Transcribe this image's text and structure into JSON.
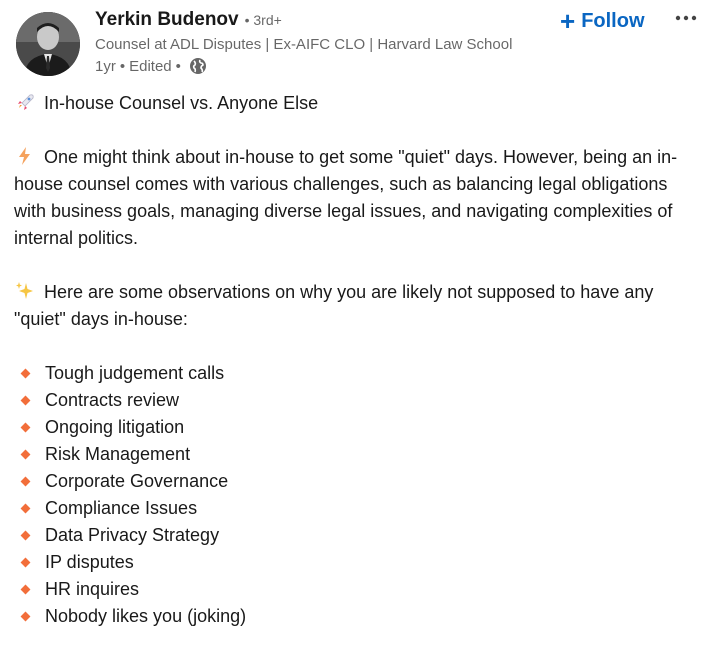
{
  "author": {
    "name": "Yerkin Budenov",
    "degree": "• 3rd+",
    "headline": "Counsel at ADL Disputes | Ex-AIFC CLO | Harvard Law School",
    "time": "1yr",
    "sep": "•",
    "edited": "Edited",
    "sep2": "•",
    "visibility_icon": "globe-icon"
  },
  "actions": {
    "follow_plus": "+",
    "follow_label": "Follow",
    "more_icon": "ellipsis-icon"
  },
  "post": {
    "title": "In-house Counsel vs. Anyone Else",
    "title_icon": "rocket-icon",
    "intro_icon": "lightning-icon",
    "intro": "One might think about in-house to get some \"quiet\" days. However, being an in-house counsel comes with various challenges, such as balancing legal obligations with business goals, managing diverse legal issues, and navigating complexities of internal politics.",
    "observe_icon": "sparkles-icon",
    "observe": "Here are some observations on why you are likely not supposed to have any \"quiet\" days in-house:",
    "bullet_color": "#f26e3a",
    "items": [
      "Tough judgement calls",
      "Contracts review",
      "Ongoing litigation",
      "Risk Management",
      "Corporate Governance",
      "Compliance Issues",
      "Data Privacy Strategy",
      "IP disputes",
      "HR inquires",
      "Nobody likes you (joking)"
    ]
  },
  "colors": {
    "link": "#0a66c2",
    "text": "#1a1a1a",
    "muted": "#666666"
  }
}
